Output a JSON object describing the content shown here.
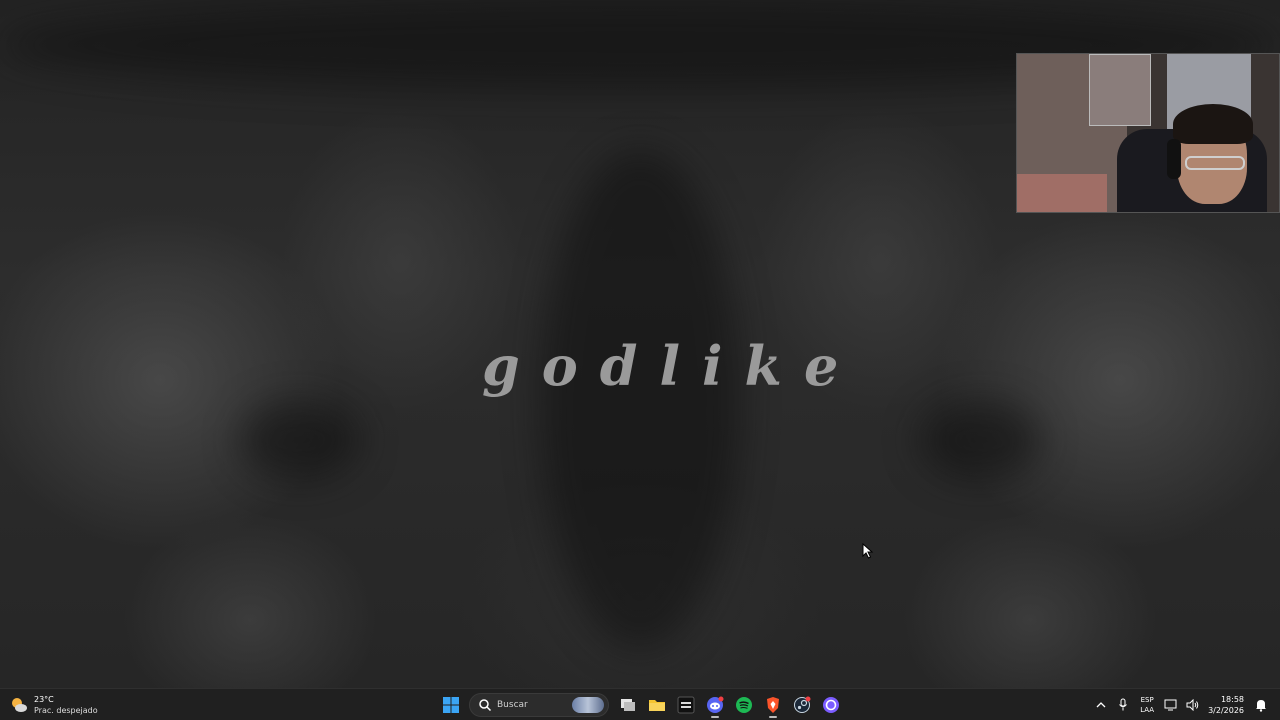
{
  "desktop": {
    "wallpaper_title": "godlike"
  },
  "taskbar": {
    "weather": {
      "temperature": "23°C",
      "condition": "Prac. despejado",
      "icon": "partly-cloudy-night-icon"
    },
    "start_icon": "windows-start-icon",
    "search": {
      "placeholder": "Buscar"
    },
    "pinned_apps": [
      {
        "name": "task-view-icon",
        "color": "#d8d8d8"
      },
      {
        "name": "file-explorer-icon",
        "color": "#f4c430"
      },
      {
        "name": "call-of-duty-icon",
        "color": "#111111"
      },
      {
        "name": "discord-icon",
        "color": "#5865f2"
      },
      {
        "name": "spotify-icon",
        "color": "#1db954"
      },
      {
        "name": "brave-browser-icon",
        "color": "#fb542b"
      },
      {
        "name": "steam-icon",
        "color": "#1b2838"
      },
      {
        "name": "obs-studio-icon",
        "color": "#7b5cff"
      }
    ],
    "tray": {
      "language_top": "ESP",
      "language_bottom": "LAA",
      "time": "18:58",
      "date": "3/2/2026"
    }
  },
  "colors": {
    "taskbar_bg": "#202020",
    "wallpaper_text": "#9a9a9a",
    "accent": "#0078d4"
  }
}
